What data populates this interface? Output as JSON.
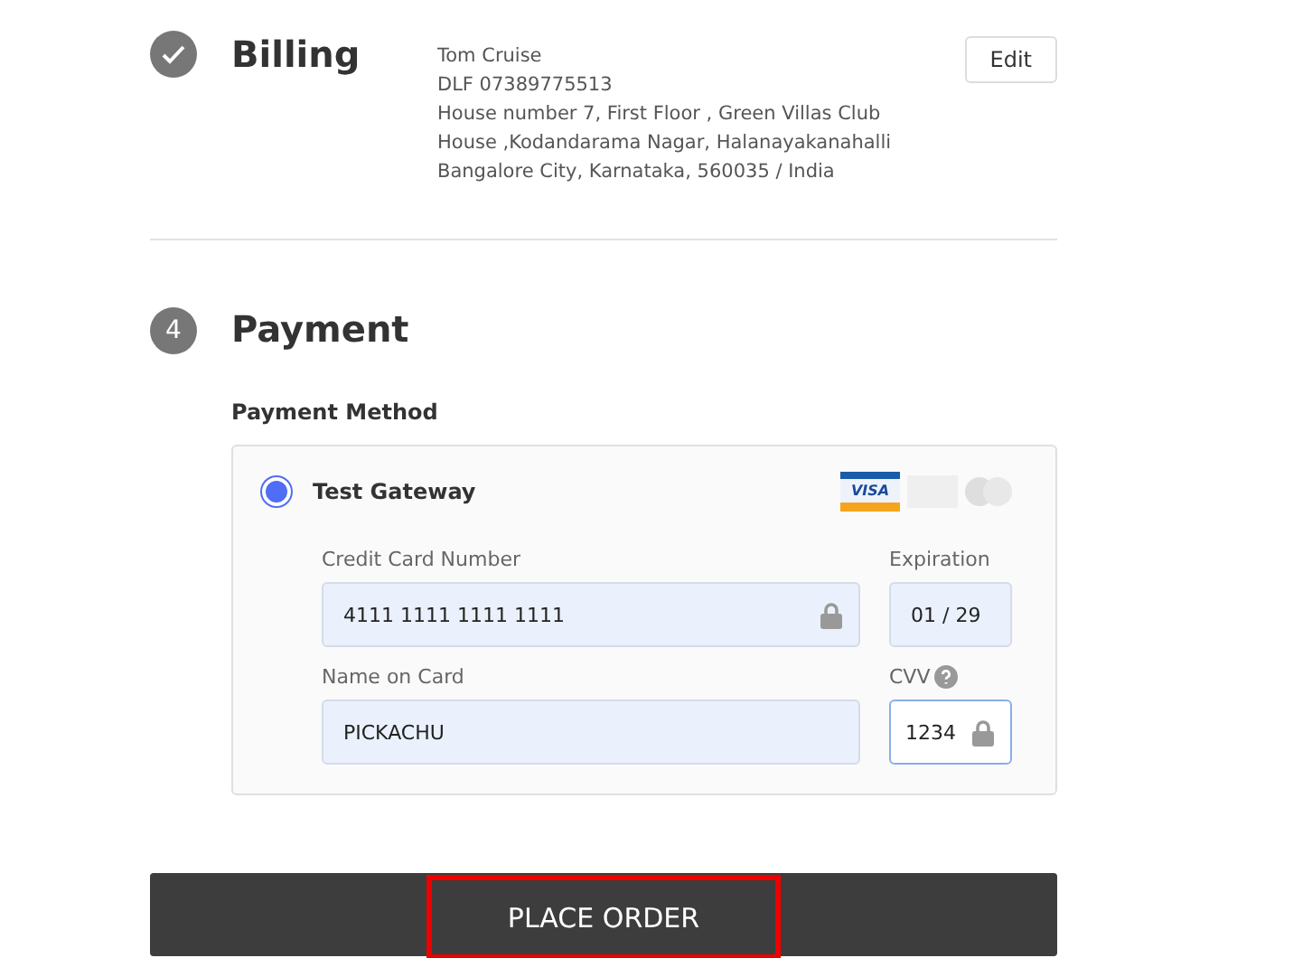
{
  "steps": [
    {
      "kind": "done",
      "title": "Billing",
      "address": [
        "Tom Cruise",
        "DLF 07389775513",
        "House number 7, First Floor , Green Villas Club",
        "House ,Kodandarama Nagar, Halanayakanahalli",
        "Bangalore City, Karnataka, 560035 / India"
      ],
      "edit_button": "Edit"
    },
    {
      "kind": "current",
      "number": "4",
      "title": "Payment"
    }
  ],
  "payment": {
    "label": "Payment Method",
    "method": {
      "name": "Test Gateway",
      "selected": true
    },
    "card_logos": [
      {
        "kind": "visa",
        "label": "VISA",
        "active": true
      },
      {
        "kind": "amex",
        "active": false
      },
      {
        "kind": "mastercard",
        "active": false
      }
    ],
    "fields": [
      {
        "label": "Credit Card Number",
        "value": "4111 1111 1111 1111",
        "lock": true,
        "focused": false
      },
      {
        "label": "Expiration",
        "value": "01 / 29",
        "focused": false
      },
      {
        "label": "Name on Card",
        "value": "PICKACHU",
        "focused": false
      },
      {
        "label": "CVV",
        "value": "1234",
        "lock": true,
        "focused": true,
        "help": true
      }
    ]
  },
  "place_order": {
    "label": "PLACE ORDER",
    "highlighted": true
  }
}
